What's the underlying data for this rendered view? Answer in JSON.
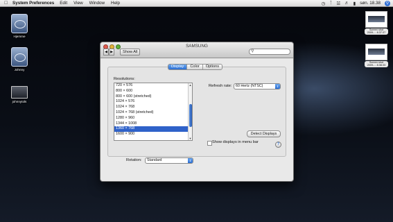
{
  "menubar": {
    "app_name": "System Preferences",
    "items": [
      "Edit",
      "View",
      "Window",
      "Help"
    ],
    "clock": "søn. 18.38"
  },
  "desktop": {
    "icons": [
      {
        "label": "Hjemme"
      },
      {
        "label": "Johnny"
      },
      {
        "label": "johnnytols"
      }
    ],
    "screenshots": [
      {
        "label": "Screen shot 2009-... 8.37.07"
      },
      {
        "label": "Screen shot 2009-... 8.38.03"
      }
    ]
  },
  "window": {
    "title": "SAMSUNG",
    "show_all": "Show All",
    "search_placeholder": "",
    "tabs": [
      {
        "label": "Display",
        "active": true
      },
      {
        "label": "Color",
        "active": false
      },
      {
        "label": "Options",
        "active": false
      }
    ],
    "resolutions_label": "Resolutions:",
    "resolutions": [
      {
        "label": "720 × 576",
        "selected": false
      },
      {
        "label": "800 × 600",
        "selected": false
      },
      {
        "label": "800 × 600 (stretched)",
        "selected": false
      },
      {
        "label": "1024 × 576",
        "selected": false
      },
      {
        "label": "1024 × 768",
        "selected": false
      },
      {
        "label": "1024 × 768 (stretched)",
        "selected": false
      },
      {
        "label": "1280 × 960",
        "selected": false
      },
      {
        "label": "1344 × 1008",
        "selected": false
      },
      {
        "label": "1360 × 768",
        "selected": true
      },
      {
        "label": "1600 × 900",
        "selected": false
      }
    ],
    "refresh_label": "Refresh rate:",
    "refresh_value": "60 Hertz (NTSC)",
    "detect_button": "Detect Displays",
    "show_in_menubar_label": "Show displays in menu bar",
    "show_in_menubar_checked": false,
    "help_symbol": "?",
    "rotation_label": "Rotation:",
    "rotation_value": "Standard"
  },
  "colors": {
    "accent": "#2f62c9",
    "selection": "#2f62c9"
  }
}
